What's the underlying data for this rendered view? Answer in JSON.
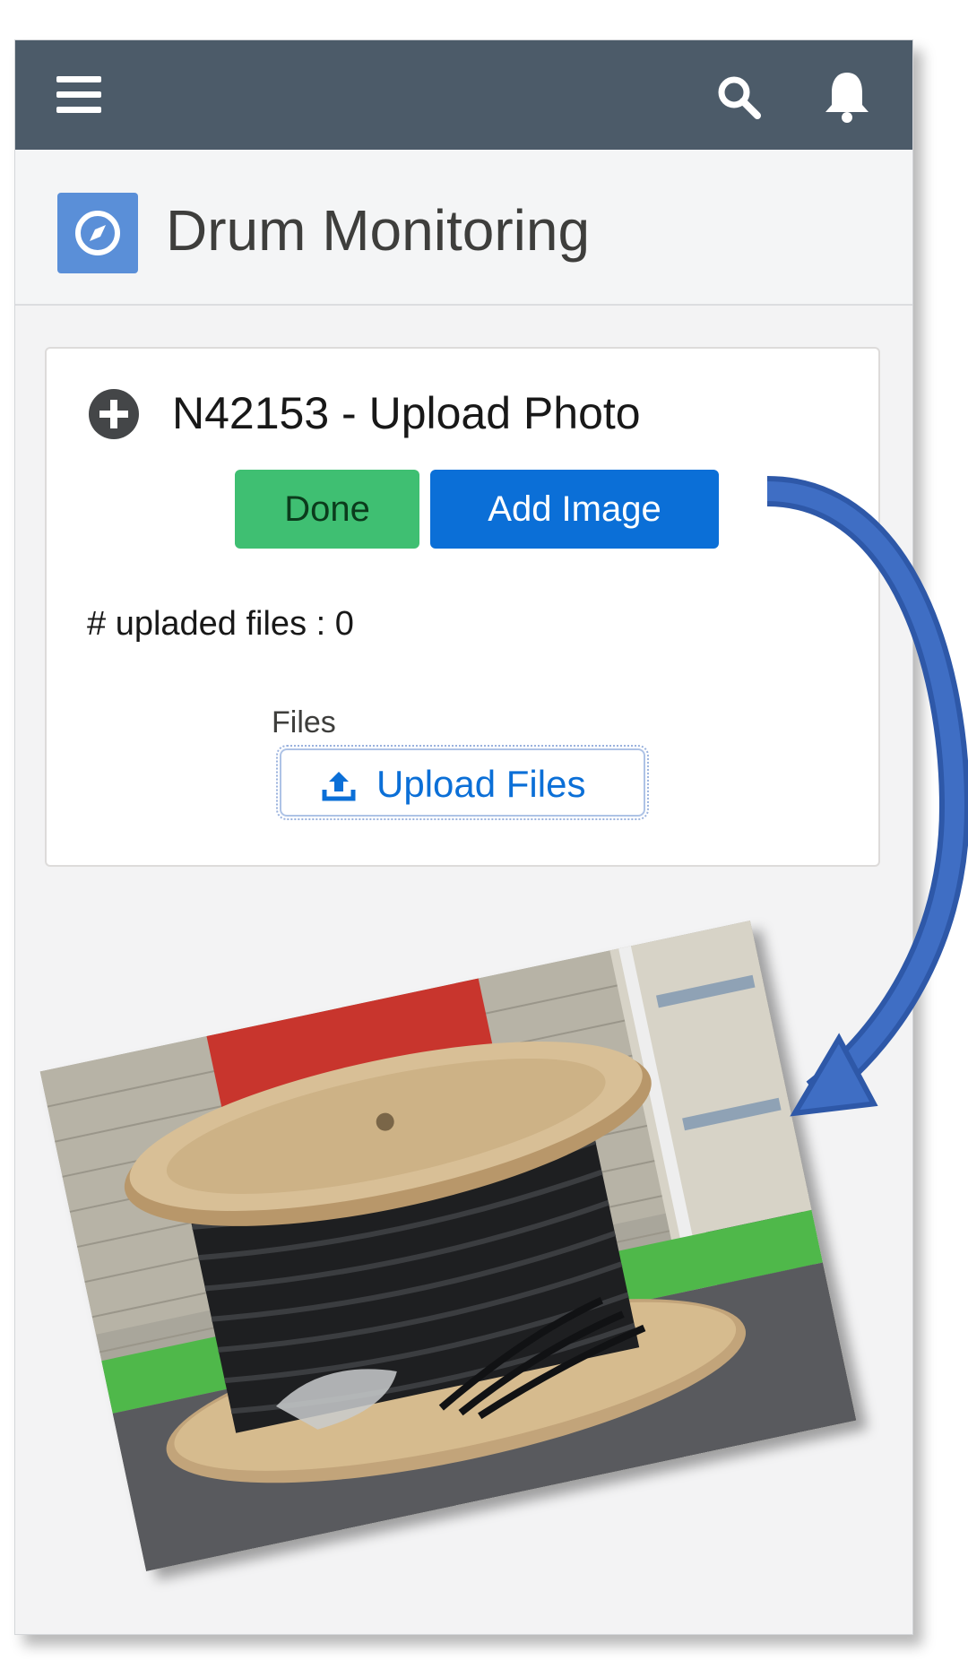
{
  "topbar": {
    "menu_icon": "hamburger-menu-icon",
    "search_icon": "search-icon",
    "notification_icon": "bell-icon",
    "background": "#4c5b69"
  },
  "header": {
    "app_icon": "compass-icon",
    "title": "Drum Monitoring"
  },
  "card": {
    "icon": "add-circle-icon",
    "title": "N42153 - Upload Photo",
    "done_label": "Done",
    "add_image_label": "Add Image",
    "uploaded_files_text": "# upladed files : 0",
    "files_label": "Files",
    "upload_files_label": "Upload Files",
    "upload_icon": "upload-icon"
  },
  "colors": {
    "done_button": "#3fbf72",
    "add_image_button": "#0b6fd7",
    "arrow": "#2e58a8",
    "app_icon_bg": "#5a8fd8"
  }
}
